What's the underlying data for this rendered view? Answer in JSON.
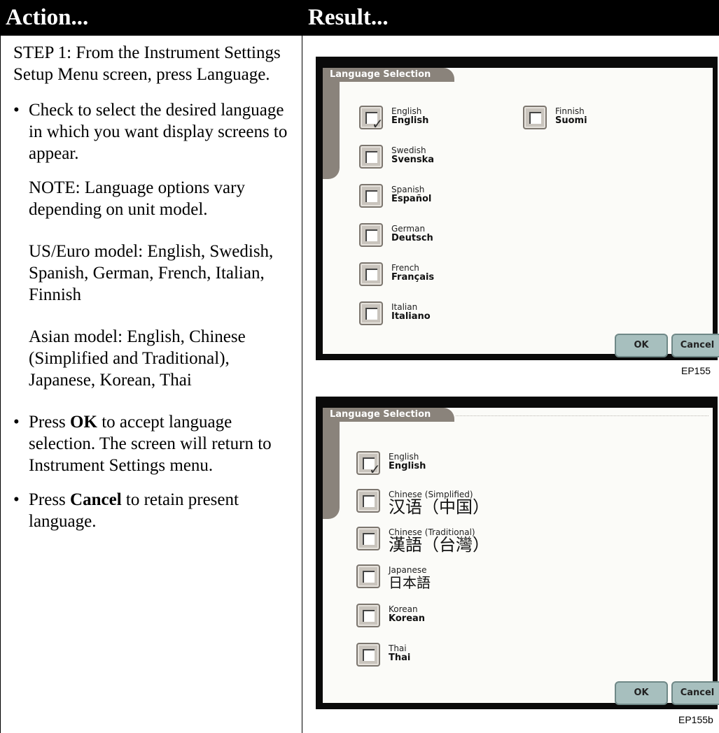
{
  "header": {
    "action": "Action...",
    "result": "Result..."
  },
  "left": {
    "step": "STEP 1: From the Instrument Settings Setup Menu screen, press Language.",
    "bullet1": "Check to select the desired language in which you want display screens to appear.",
    "note": "NOTE: Language options vary depending on unit model.",
    "us_model": "US/Euro model: English, Swedish, Spanish, German, French, Italian, Finnish",
    "asian_model": "Asian model: English, Chinese (Simplified and Traditional), Japanese, Korean, Thai",
    "bullet2_pre": "Press ",
    "bullet2_bold": "OK",
    "bullet2_post": " to accept language selection. The screen will return to Instrument Settings menu.",
    "bullet3_pre": "Press ",
    "bullet3_bold": "Cancel",
    "bullet3_post": " to retain present language.",
    "bullet_glyph": "•"
  },
  "screen1": {
    "title": "Language Selection",
    "ok": "OK",
    "cancel": "Cancel",
    "code": "EP155",
    "items": [
      {
        "name": "English",
        "native": "English",
        "checked": true
      },
      {
        "name": "Swedish",
        "native": "Svenska",
        "checked": false
      },
      {
        "name": "Spanish",
        "native": "Español",
        "checked": false
      },
      {
        "name": "German",
        "native": "Deutsch",
        "checked": false
      },
      {
        "name": "French",
        "native": "Français",
        "checked": false
      },
      {
        "name": "Italian",
        "native": "Italiano",
        "checked": false
      },
      {
        "name": "Finnish",
        "native": "Suomi",
        "checked": false
      }
    ]
  },
  "screen2": {
    "title": "Language Selection",
    "ok": "OK",
    "cancel": "Cancel",
    "code": "EP155b",
    "items": [
      {
        "name": "English",
        "native": "English",
        "checked": true
      },
      {
        "name": "Chinese (Simplified)",
        "native": "汉语（中国）",
        "checked": false
      },
      {
        "name": "Chinese (Traditional)",
        "native": "漢語（台灣）",
        "checked": false
      },
      {
        "name": "Japanese",
        "native": "日本語",
        "checked": false
      },
      {
        "name": "Korean",
        "native": "Korean",
        "checked": false
      },
      {
        "name": "Thai",
        "native": "Thai",
        "checked": false
      }
    ]
  },
  "check_glyph": "✓"
}
